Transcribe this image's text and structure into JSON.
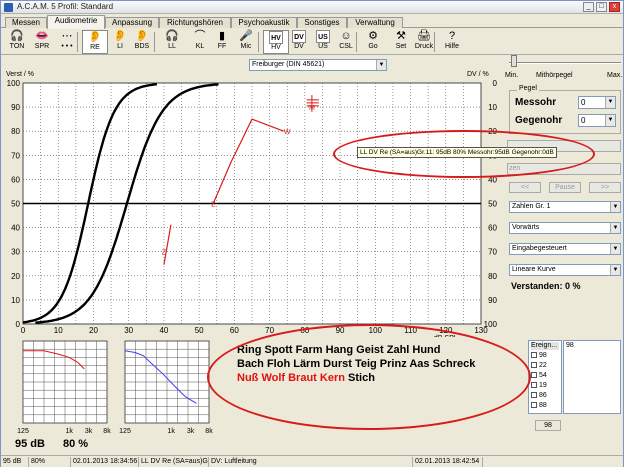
{
  "window": {
    "title": "A.C.A.M. 5  Profil: Standard",
    "close_label": "x"
  },
  "tabs": [
    "Messen",
    "Audiometrie",
    "Anpassung",
    "Richtungshören",
    "Psychoakustik",
    "Sonstiges",
    "Verwaltung"
  ],
  "toolbar": [
    {
      "label": "TON",
      "icon": "headphones-icon",
      "glyph": "🎧"
    },
    {
      "label": "SPR",
      "icon": "lips-icon",
      "glyph": "👄"
    },
    {
      "label": "• • •",
      "icon": "dots-icon",
      "glyph": "⋯"
    },
    {
      "label": "RE",
      "icon": "ear-right-icon",
      "glyph": "👂"
    },
    {
      "label": "LI",
      "icon": "ear-left-icon",
      "glyph": "👂"
    },
    {
      "label": "BDS",
      "icon": "ears-both-icon",
      "glyph": "👂"
    },
    {
      "label": "LL",
      "icon": "headset-icon",
      "glyph": "🎧"
    },
    {
      "label": "KL",
      "icon": "bone-conductor-icon",
      "glyph": "⌒"
    },
    {
      "label": "FF",
      "icon": "speaker-icon",
      "glyph": "▮"
    },
    {
      "label": "Mic",
      "icon": "microphone-icon",
      "glyph": "🎤"
    },
    {
      "label": "HV",
      "icon": "hv-icon",
      "glyph": "HV"
    },
    {
      "label": "DV",
      "icon": "dv-icon",
      "glyph": "DV"
    },
    {
      "label": "US",
      "icon": "us-icon",
      "glyph": "US"
    },
    {
      "label": "CSL",
      "icon": "csl-icon",
      "glyph": "☺"
    },
    {
      "label": "Go",
      "icon": "go-icon",
      "glyph": "⚙"
    },
    {
      "label": "Set",
      "icon": "settings-icon",
      "glyph": "⚒"
    },
    {
      "label": "Druck",
      "icon": "printer-icon",
      "glyph": "🖨"
    },
    {
      "label": "Hilfe",
      "icon": "help-icon",
      "glyph": "?"
    }
  ],
  "test_select": "Freiburger (DIN 45621)",
  "main_chart": {
    "y_left_label": "Verst / %",
    "y_right_label": "DV / %",
    "x_unit": "dB SPL",
    "xlim": [
      0,
      130
    ],
    "x_ticks": [
      "0",
      "10",
      "20",
      "30",
      "40",
      "50",
      "60",
      "70",
      "80",
      "90",
      "100",
      "110",
      "120",
      "130"
    ],
    "y_left_ticks": [
      "100",
      "90",
      "80",
      "70",
      "60",
      "50",
      "40",
      "30",
      "20",
      "10",
      "0"
    ],
    "y_right_ticks": [
      "0",
      "10",
      "20",
      "30",
      "40",
      "50",
      "60",
      "70",
      "80",
      "90",
      "100"
    ],
    "markers": [
      {
        "text": "Z",
        "x": 40,
        "y": 30
      },
      {
        "text": "Z",
        "x": 54,
        "y": 50
      },
      {
        "text": "W",
        "x": 75,
        "y": 80
      },
      {
        "text": "M",
        "x": 82,
        "y": 90
      }
    ]
  },
  "slider": {
    "min_label": "Min.",
    "mid_label": "Mithörpegel",
    "max_label": "Max.",
    "value_fraction": 0.02
  },
  "pegel": {
    "title": "Pegel",
    "messohr_label": "Messohr",
    "messohr_value": "0",
    "gegenohr_label": "Gegenohr",
    "gegenohr_value": "0"
  },
  "tooltip": "LL DV Re (SA=aus)Gr.11: 95dB  80% Messohr:95dB Gegenohr:0dB",
  "playback": {
    "prev": "<<",
    "pause": "Pause",
    "next": ">>",
    "side_label": "Stop",
    "side_label2": "zen"
  },
  "selects": [
    "Zahlen Gr. 1",
    "Vorwärts",
    "Eingabegesteuert",
    "Lineare Kurve"
  ],
  "verstanden": "Verstanden: 0 %",
  "mini_left": {
    "x_ticks": [
      "125",
      "1k",
      "3k",
      "8k"
    ]
  },
  "mini_right": {
    "x_ticks": [
      "125",
      "1k",
      "3k",
      "8k"
    ]
  },
  "summary": {
    "level": "95 dB",
    "percent": "80 %"
  },
  "speech_words": {
    "line1": "Ring Spott Farm Hang Geist Zahl Hund",
    "line2": "Bach Floh Lärm Durst Teig Prinz Aas Schreck",
    "line3_red": "Nuß Wolf Braut Kern",
    "line3_black": " Stich"
  },
  "ereign": {
    "header": "Ereign...",
    "rows": [
      "98",
      "22",
      "54",
      "19",
      "86",
      "88"
    ],
    "right_header": "98",
    "button": "98"
  },
  "status_bar": [
    "95 dB",
    "80%",
    "02.01.2013 18:34:56",
    "LL DV Re (SA=aus)Gr",
    "DV: Luftleitung",
    "02.01.2013 18:42:54"
  ],
  "colors": {
    "accent": "#d91a1a",
    "curve": "#000000",
    "marker": "#d91a1a",
    "mini_line": "#3d3df0"
  }
}
